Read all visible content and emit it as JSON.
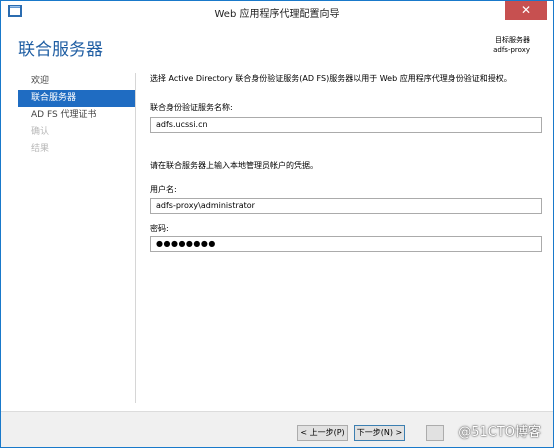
{
  "window": {
    "title": "Web 应用程序代理配置向导",
    "close_glyph": "✕"
  },
  "header": {
    "page_title": "联合服务器",
    "destination_label": "目标服务器",
    "destination_value": "adfs-proxy"
  },
  "nav": {
    "items": [
      {
        "label": "欢迎",
        "state": "normal"
      },
      {
        "label": "联合服务器",
        "state": "active"
      },
      {
        "label": "AD FS 代理证书",
        "state": "normal"
      },
      {
        "label": "确认",
        "state": "disabled"
      },
      {
        "label": "结果",
        "state": "disabled"
      }
    ]
  },
  "main": {
    "description": "选择 Active Directory 联合身份验证服务(AD FS)服务器以用于 Web 应用程序代理身份验证和授权。",
    "service_name_label": "联合身份验证服务名称:",
    "service_name_value": "adfs.ucssi.cn",
    "credentials_hint": "请在联合服务器上输入本地管理员帐户的凭据。",
    "username_label": "用户名:",
    "username_value": "adfs-proxy\\administrator",
    "password_label": "密码:",
    "password_value": "●●●●●●●●"
  },
  "buttons": {
    "prev_label": "< 上一步(P)",
    "next_label": "下一步(N) >",
    "extra_label": ""
  },
  "watermark": {
    "text": "@51CTO博客"
  },
  "colors": {
    "accent": "#1f6cc2",
    "title_blue": "#1f5ea3",
    "close_red": "#c75050"
  }
}
